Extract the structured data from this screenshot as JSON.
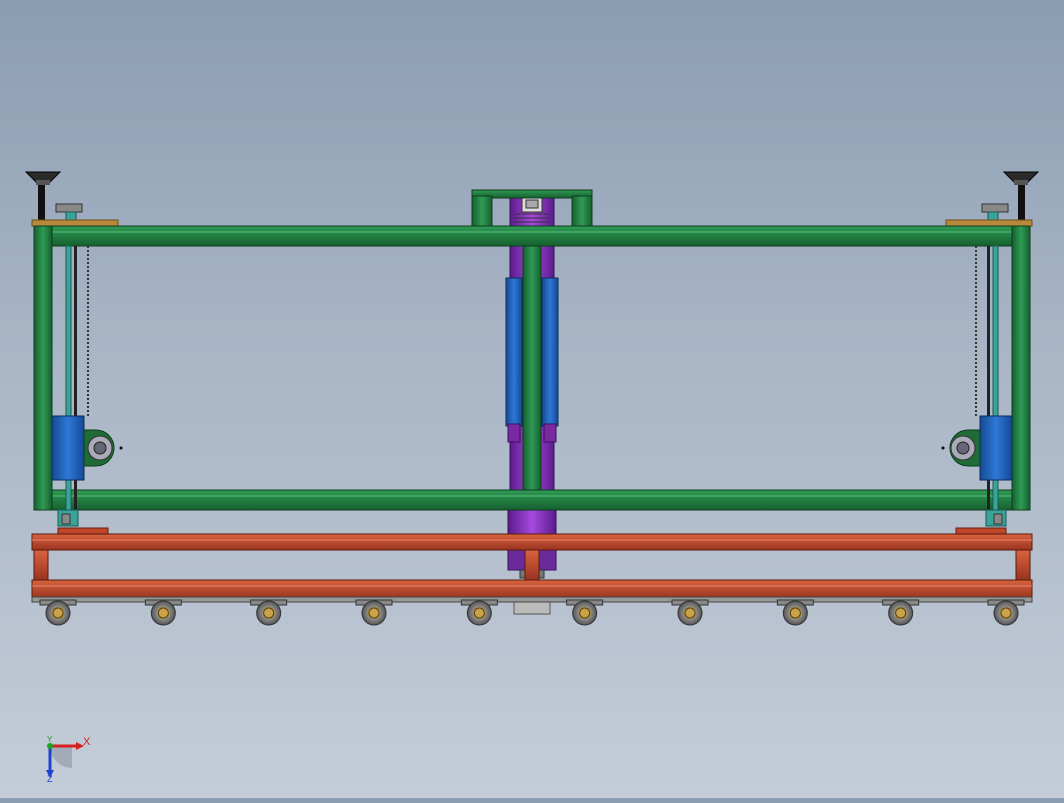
{
  "view": {
    "background_top": "#8b9db2",
    "background_bottom": "#c4ccd8"
  },
  "model": {
    "frame_color": "#1f7a3e",
    "base_color": "#c0462a",
    "cylinder_color": "#8a2cc9",
    "actuator_color": "#1f5fb8",
    "bracket_color": "#3aa39a",
    "plate_color": "#b8893a",
    "caster_count": 10
  },
  "triad": {
    "x_label": "X",
    "y_label": "Y",
    "z_label": "Z",
    "x_color": "#d42020",
    "y_color": "#20a020",
    "z_color": "#2040d0"
  }
}
